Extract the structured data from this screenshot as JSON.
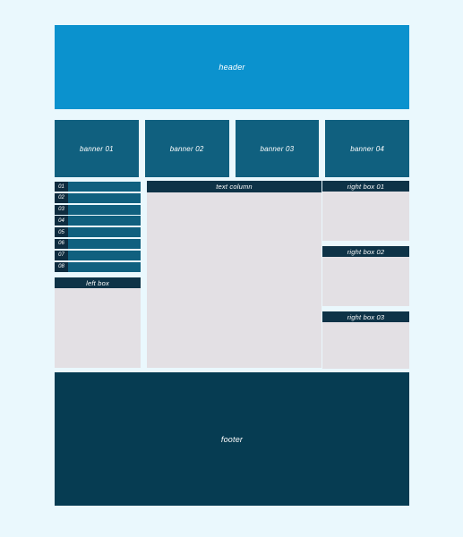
{
  "page": {
    "background_color": "#eaf8fd"
  },
  "header": {
    "label": "header",
    "color": "#0b92ce"
  },
  "banners": {
    "color": "#10607f",
    "items": [
      {
        "label": "banner 01"
      },
      {
        "label": "banner 02"
      },
      {
        "label": "banner 03"
      },
      {
        "label": "banner 04"
      }
    ]
  },
  "left_column": {
    "list": {
      "bar_color": "#10607f",
      "tag_color": "#0e2c3f",
      "rows": [
        {
          "number": "01"
        },
        {
          "number": "02"
        },
        {
          "number": "03"
        },
        {
          "number": "04"
        },
        {
          "number": "05"
        },
        {
          "number": "06"
        },
        {
          "number": "07"
        },
        {
          "number": "08"
        }
      ]
    },
    "box": {
      "label": "left box",
      "head_color": "#0e3347",
      "body_color": "#e3e0e4"
    }
  },
  "center_column": {
    "label": "text column",
    "head_color": "#0e3347",
    "body_color": "#e3e0e4"
  },
  "right_column": {
    "head_color": "#0e3347",
    "body_color": "#e3e0e4",
    "boxes": [
      {
        "label": "right box 01"
      },
      {
        "label": "right box 02"
      },
      {
        "label": "right box 03"
      }
    ]
  },
  "footer": {
    "label": "footer",
    "color": "#063c52"
  }
}
